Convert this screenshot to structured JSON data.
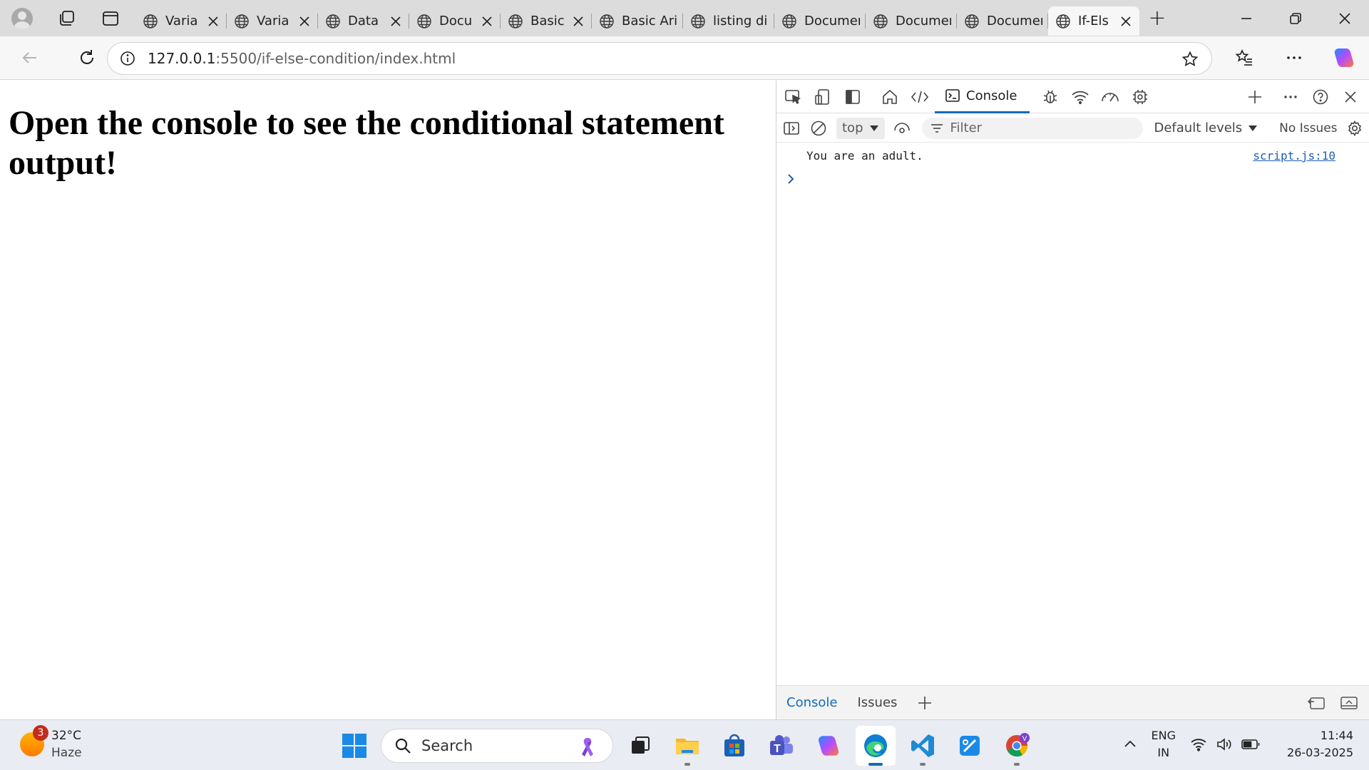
{
  "browser": {
    "tabs": [
      {
        "title": "Varia",
        "closable": true,
        "active": false
      },
      {
        "title": "Varia",
        "closable": true,
        "active": false
      },
      {
        "title": "Data",
        "closable": true,
        "active": false
      },
      {
        "title": "Docu",
        "closable": true,
        "active": false
      },
      {
        "title": "Basic",
        "closable": true,
        "active": false
      },
      {
        "title": "Basic Arit",
        "closable": false,
        "active": false
      },
      {
        "title": "listing di",
        "closable": false,
        "active": false
      },
      {
        "title": "Documer",
        "closable": false,
        "active": false
      },
      {
        "title": "Documer",
        "closable": false,
        "active": false
      },
      {
        "title": "Documer",
        "closable": false,
        "active": false
      },
      {
        "title": "If-Els",
        "closable": true,
        "active": true
      }
    ],
    "url_host": "127.0.0.1",
    "url_rest": ":5500/if-else-condition/index.html"
  },
  "page": {
    "heading": "Open the console to see the conditional statement output!"
  },
  "devtools": {
    "active_tab": "Console",
    "context": "top",
    "filter_placeholder": "Filter",
    "levels": "Default levels",
    "issues": "No Issues",
    "console_messages": [
      {
        "text": "You are an adult.",
        "source": "script.js:10"
      }
    ],
    "drawer_tabs": [
      "Console",
      "Issues"
    ]
  },
  "taskbar": {
    "weather": {
      "temp": "32°C",
      "condition": "Haze",
      "badge": "3"
    },
    "search_placeholder": "Search",
    "tray": {
      "lang1": "ENG",
      "lang2": "IN",
      "time": "11:44",
      "date": "26-03-2025"
    }
  },
  "colors": {
    "accent": "#0f6cbd",
    "link": "#1a5fb4",
    "tab_strip": "#dcdcdc"
  }
}
